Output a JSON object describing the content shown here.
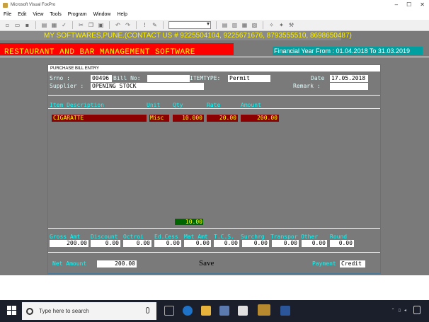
{
  "app": {
    "window_title": "Microsoft Visual FoxPro"
  },
  "menu": {
    "items": [
      "File",
      "Edit",
      "View",
      "Tools",
      "Program",
      "Window",
      "Help"
    ]
  },
  "banner": {
    "contact": "MY SOFTWARES,PUNE.(CONTACT US # 9225504104, 9225671676, 8793555510, 8698650487)",
    "product": "RESTAURANT  AND  BAR  MANAGEMENT  SOFTWARE",
    "financial_year": "Financial Year From : 01.04.2018 To 31.03.2019"
  },
  "form": {
    "title": "PURCHASE BILL ENTRY",
    "srno_label": "Srno      :",
    "srno_value": "00496",
    "billno_label": "Bill No:",
    "billno_value": "",
    "itemtype_label": "ITEMTYPE:",
    "itemtype_value": "Permit",
    "date_label": "Date",
    "date_value": "17.05.2018",
    "supplier_label": "Supplier :",
    "supplier_value": "OPENING STOCK",
    "remark_label": "Remark :",
    "remark_value": "",
    "columns": {
      "item": "Item Description",
      "unit": "Unit",
      "qty": "Qty",
      "rate": "Rate",
      "amount": "Amount"
    },
    "rows": [
      {
        "item": "CIGARATTE",
        "unit": "Misc",
        "qty": "10.000",
        "rate": "20.00",
        "amount": "200.00"
      }
    ],
    "total_qty": "10.00",
    "charges": [
      {
        "label": "Gross Amt",
        "value": "200.00"
      },
      {
        "label": "Discount",
        "value": "0.00"
      },
      {
        "label": "Octroi",
        "value": "0.00"
      },
      {
        "label": "Ed.Cess",
        "value": "0.00"
      },
      {
        "label": "Mat Amt",
        "value": "0.00"
      },
      {
        "label": "T.C.S.",
        "value": "0.00"
      },
      {
        "label": "Surchrg",
        "value": "0.00"
      },
      {
        "label": "Transpor",
        "value": "0.00"
      },
      {
        "label": "Other",
        "value": "0.00"
      },
      {
        "label": "Round",
        "value": "0.00"
      }
    ],
    "net_amount_label": "Net Amount",
    "net_amount_value": "200.00",
    "save_label": "Save",
    "payment_label": "Payment",
    "payment_value": "Credit"
  },
  "taskbar": {
    "search_placeholder": "Type here to search"
  },
  "colors": {
    "banner_yellow": "#fff200",
    "banner_red": "#ff0000",
    "fy_teal": "#00a0a0",
    "row_dark_red": "#8b0000",
    "total_green": "#006400"
  }
}
